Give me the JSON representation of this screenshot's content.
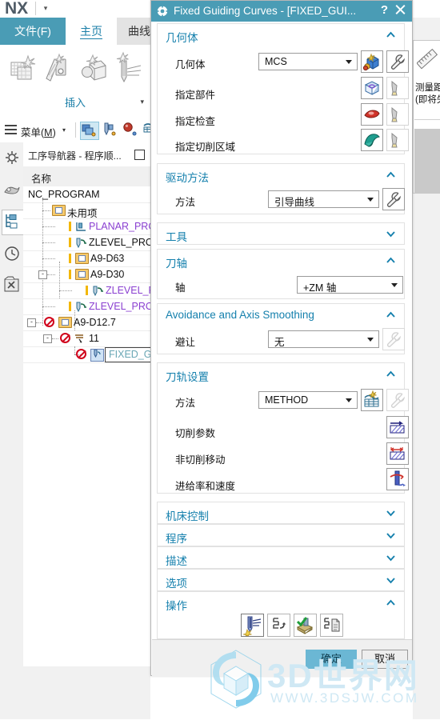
{
  "app": {
    "logo": "NX",
    "qat_caret": "▾",
    "tabs": [
      {
        "label": "文件(F)",
        "name": "tab-file"
      },
      {
        "label": "主页",
        "name": "tab-home"
      },
      {
        "label": "曲线",
        "name": "tab-curve"
      }
    ],
    "ribbon": {
      "group_label": "插入",
      "caret": "▾",
      "icons": [
        "create-geometry-icon",
        "create-tool-icon",
        "create-method-icon",
        "create-operation-icon"
      ]
    },
    "menubar": {
      "menu_label_pre": "菜单(",
      "menu_label_key": "M",
      "menu_label_post": ")",
      "caret": "▾",
      "icons": [
        "create-program-icon",
        "create-tool-icon",
        "create-geometry-icon",
        "create-method-icon"
      ]
    },
    "rail": {
      "items": [
        {
          "name": "rail-item-settings",
          "icon": "gear-icon"
        },
        {
          "name": "rail-item-part-navigator",
          "icon": "part-navigator-icon"
        },
        {
          "name": "rail-item-operation-navigator",
          "icon": "operation-navigator-icon"
        },
        {
          "name": "rail-item-history",
          "icon": "clock-icon"
        },
        {
          "name": "rail-item-tools",
          "icon": "tools-icon"
        }
      ]
    }
  },
  "navigator": {
    "title": "工序导航器 - 程序顺...",
    "pin_icon": "pin-window-icon",
    "column_header": "名称",
    "rows": [
      {
        "label": "NC_PROGRAM",
        "indent": 0,
        "color": "black",
        "icons": [],
        "expander": "",
        "bar": false
      },
      {
        "label": "未用项",
        "indent": 1,
        "color": "black",
        "icons": [
          "folder-icon"
        ],
        "expander": "",
        "bar": false
      },
      {
        "label": "PLANAR_PROFILE",
        "indent": 2,
        "color": "purple",
        "icons": [
          "planar-profile-icon"
        ],
        "expander": "",
        "bar": true
      },
      {
        "label": "ZLEVEL_PROFILE",
        "indent": 2,
        "color": "black",
        "icons": [
          "zlevel-profile-icon"
        ],
        "expander": "",
        "bar": true
      },
      {
        "label": "A9-D63",
        "indent": 2,
        "color": "black",
        "icons": [
          "folder-icon"
        ],
        "expander": "",
        "bar": true
      },
      {
        "label": "A9-D30",
        "indent": 2,
        "color": "black",
        "icons": [
          "folder-icon"
        ],
        "expander": "-",
        "bar": true
      },
      {
        "label": "ZLEVEL_PROFILE",
        "indent": 3,
        "color": "purple",
        "icons": [
          "zlevel-profile-icon"
        ],
        "expander": "",
        "bar": true
      },
      {
        "label": "ZLEVEL_PROFILE",
        "indent": 2,
        "color": "purple",
        "icons": [
          "zlevel-profile-icon"
        ],
        "expander": "",
        "bar": true
      },
      {
        "label": "A9-D12.7",
        "indent": 1,
        "color": "black",
        "icons": [
          "no-entry-icon",
          "folder-icon"
        ],
        "expander": "-",
        "bar": false
      },
      {
        "label": "11",
        "indent": 2,
        "color": "black",
        "icons": [
          "no-entry-icon",
          "operation-icon"
        ],
        "expander": "-",
        "bar": false
      },
      {
        "label": "FIXED_GU",
        "indent": 3,
        "color": "teal",
        "icons": [
          "no-entry-icon",
          "fixed-contour-icon"
        ],
        "expander": "",
        "bar": false,
        "selected": true
      }
    ]
  },
  "tooltip_panel": {
    "icon": "ruler-icon",
    "line1": "测量距离",
    "line2": "(即将失"
  },
  "dialog": {
    "title": "Fixed Guiding Curves - [FIXED_GUI...",
    "gear_icon": "gear-icon",
    "help_label": "?",
    "close_icon": "close-icon",
    "sections": [
      {
        "name": "geometry",
        "title": "几何体",
        "state": "expanded",
        "chevron": "▲",
        "rows": [
          {
            "label": "几何体",
            "combo": "MCS",
            "buttons": [
              "mcs-icon",
              "edit-wrench-icon"
            ]
          },
          {
            "label": "指定部件",
            "combo": null,
            "buttons": [
              "select-part-icon",
              "display-part-icon"
            ]
          },
          {
            "label": "指定检查",
            "combo": null,
            "buttons": [
              "check-body-icon",
              "display-check-icon"
            ]
          },
          {
            "label": "指定切削区域",
            "combo": null,
            "buttons": [
              "cut-area-icon",
              "display-cut-area-icon"
            ]
          }
        ]
      },
      {
        "name": "drive-method",
        "title": "驱动方法",
        "state": "expanded",
        "chevron": "▲",
        "rows": [
          {
            "label": "方法",
            "combo": "引导曲线",
            "buttons": [
              "edit-wrench-icon"
            ]
          }
        ]
      },
      {
        "name": "tool",
        "title": "工具",
        "state": "collapsed",
        "chevron": "▼",
        "rows": []
      },
      {
        "name": "tool-axis",
        "title": "刀轴",
        "state": "expanded",
        "chevron": "▲",
        "rows": [
          {
            "label": "轴",
            "combo": "+ZM 轴",
            "buttons": []
          }
        ]
      },
      {
        "name": "avoidance-axis-smoothing",
        "title": "Avoidance and Axis Smoothing",
        "state": "expanded",
        "chevron": "▲",
        "rows": [
          {
            "label": "避让",
            "combo": "无",
            "buttons": [
              "edit-wrench-icon"
            ]
          }
        ]
      },
      {
        "name": "path-settings",
        "title": "刀轨设置",
        "state": "expanded",
        "chevron": "▲",
        "rows": [
          {
            "label": "方法",
            "combo": "METHOD",
            "buttons": [
              "method-icon",
              "edit-wrench-icon"
            ]
          },
          {
            "label": "切削参数",
            "combo": null,
            "buttons": [
              "cutting-parameters-icon"
            ]
          },
          {
            "label": "非切削移动",
            "combo": null,
            "buttons": [
              "non-cutting-moves-icon"
            ]
          },
          {
            "label": "进给率和速度",
            "combo": null,
            "buttons": [
              "feeds-speeds-icon"
            ]
          }
        ]
      },
      {
        "name": "machine-control",
        "title": "机床控制",
        "state": "collapsed",
        "chevron": "▼",
        "rows": []
      },
      {
        "name": "program",
        "title": "程序",
        "state": "collapsed",
        "chevron": "▼",
        "rows": []
      },
      {
        "name": "description",
        "title": "描述",
        "state": "collapsed",
        "chevron": "▼",
        "rows": []
      },
      {
        "name": "options",
        "title": "选项",
        "state": "collapsed",
        "chevron": "▼",
        "rows": []
      },
      {
        "name": "actions",
        "title": "操作",
        "state": "expanded",
        "chevron": "▲",
        "buttons": [
          "generate-icon",
          "replay-icon",
          "verify-icon",
          "list-icon"
        ]
      }
    ],
    "footer": {
      "ok_label": "确定",
      "cancel_label": "取消"
    }
  },
  "watermark": {
    "big": "3D世界网",
    "small": "WWW.3DSJW.COM",
    "color": "#cfe8f4"
  }
}
